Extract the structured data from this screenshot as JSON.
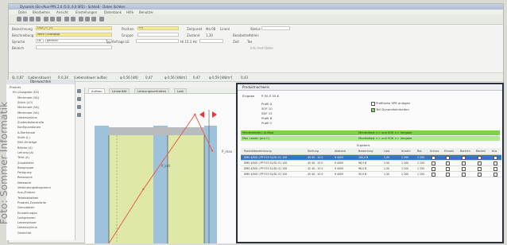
{
  "watermark": "Foto: Sommer Informatik",
  "window": {
    "title": "Dynamik (Ein-/Aus-PPS 2.0 (5.0, 6.0 SP2) - Schließ - Daten Sichten",
    "menu": [
      "Datei",
      "Bearbeiten",
      "Ansicht",
      "Einstellungen",
      "Datenbank",
      "Hilfe",
      "Benutzer"
    ]
  },
  "form": {
    "bezeichnung_label": "Bezeichnung",
    "bezeichnung_value": "DSA_FF_01",
    "beschreibung_label": "Beschreibung",
    "beschreibung_value": "Werk Ludwigsgr.",
    "sprache_label": "Sprache",
    "sprache_value": "DE",
    "sprache_value2": "german",
    "bereich_label": "Bereich",
    "position_label": "Position",
    "position_value": "FH",
    "gruppe_label": "Gruppe",
    "typ_label": "Typ Anfrage LE",
    "zeitpunkt_label": "Zeitpunkt",
    "zeitpunkt_value": "Ma 08",
    "zeitpunkt_mode": "Lineal",
    "zustand_label": "Zustand",
    "zustand_value": "1,30",
    "bearbeiter_label": "Bearbeiter",
    "bearbeiter_value": "Admin",
    "status_label": "Status",
    "zeit_label": "Zeit",
    "hi_label": "Hi 15.1 Hz",
    "tex_label": "Tex",
    "hint": "Info test-Datei"
  },
  "statusline": {
    "items": [
      "Q₁ 0,87",
      "(Lebensdauer)",
      "R 0,34",
      "(Lebensdauer aufbe)",
      "φ 0,56 [kN]",
      "0,47",
      "φ 0,56 [kN/m]",
      "0,47",
      "φ 0,59 [kN/m²]",
      "0,43"
    ]
  },
  "tree": {
    "header": "Überwachten",
    "items": [
      "Produkt",
      "Ein-/Ausgabe (EA)",
      "Merkmale (VA)",
      "Stück (LO)",
      "Merkmale (VA)",
      "Merkmale (VA)",
      "Lebenszyklus",
      "Zustandskontrolle",
      "Konfigurationen",
      "A-Merkmale",
      "Stufe (L)",
      "EKO-Einträge",
      "Blöcke (A)",
      "Leitung (A)",
      "Teile (A)",
      "Zusatzteile",
      "Baugruppe",
      "Fertigung",
      "Ressource",
      "Netzwerk",
      "Verbindungsdiagramm",
      "Aus-/Einbau",
      "Teilebibliothek",
      "Produkt-Zusatzteile",
      "Grenzdaten",
      "Einstellungen",
      "Lastgrenzen",
      "Lebensdauer",
      "Lebenszyklus",
      "Gewichte"
    ]
  },
  "chart_tabs": [
    "Aufbau",
    "Linearität",
    "Leistungsverhalten",
    "Last"
  ],
  "chart_data": {
    "type": "line",
    "title": "",
    "xlabel": "",
    "ylabel": "",
    "series": [
      {
        "values": [
          [
            0,
            0
          ],
          [
            40,
            42
          ],
          [
            100,
            100
          ],
          [
            120,
            72
          ]
        ]
      }
    ],
    "annotations": [
      "P_krit",
      "P_max"
    ]
  },
  "dialog": {
    "title": "Produktnachweis",
    "eingabe_label": "Eingabe",
    "eingabe_value": "P-50-S 50-K",
    "params": [
      "Profil A",
      "SOF 10",
      "SDF 15",
      "Profil B",
      "Profil C"
    ],
    "checkbox1": "Profilierte SPR anlegen",
    "checkbox2": "Teil Dynamikeinheiten",
    "bar1_left": "Mindestdaten: Auflast",
    "bar1_right": "Mindestlast >= und SOK >= Vorgabe",
    "bar2_left": "Max Lasten (pro C)",
    "bar2_right": "Mindestlast >= und SOK >= Vorgabe",
    "grid_group": "Ergebnis",
    "columns": [
      "Produktbezeichnung",
      "Stellung",
      "Abstand",
      "Bewertung",
      "Last",
      "Anzahl",
      "Bst.",
      "Schutz",
      "Einsatz",
      "Bereich",
      "Bauteil",
      "Aus"
    ],
    "rows": [
      {
        "name": "DMS 4/500 | PP 575 S1/D1 S1 100",
        "a": "45 50 - 10 0",
        "b": "9 4005",
        "c": "100,0 B",
        "d": "2,00",
        "e": "1 200",
        "f": "1 200",
        "sel": true
      },
      {
        "name": "DMS 4/500 | PP 575 S1/D1 S1 100",
        "a": "45 40 - 15 0",
        "b": "9 4005",
        "c": "98,5 B",
        "d": "2,00",
        "e": "1 200",
        "f": "1 200",
        "sel": false
      },
      {
        "name": "DMS 4/500 | PP 575 S1/D1 S1 100",
        "a": "42 40 - 10 0",
        "b": "9 4005",
        "c": "96,0 B",
        "d": "1,50",
        "e": "1 200",
        "f": "1 200",
        "sel": false
      },
      {
        "name": "DMS 4/500 | PP 575 S1/D1 S1 100",
        "a": "45 40 - 10 0",
        "b": "9 4005",
        "c": "95,0 B",
        "d": "1,50",
        "e": "1 200",
        "f": "1 200",
        "sel": false
      }
    ]
  },
  "colors": {
    "field_yellow": "#f3ef8e",
    "chart_beam": "#9fc2dc",
    "chart_fill": "#dfe8a6",
    "chart_line": "#e6604c",
    "dialog_green": "#7ad34a",
    "selection_blue": "#2d78c8"
  }
}
